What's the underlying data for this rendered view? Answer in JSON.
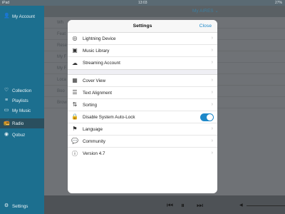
{
  "statusbar": {
    "carrier": "iPad",
    "time": "13:03",
    "battery": "27%"
  },
  "sidebar": {
    "account": "My Account",
    "collection": "Collection",
    "playlists": "Playlists",
    "mymusic": "My Music",
    "radio": "Radio",
    "qobuz": "Qobuz",
    "settings": "Settings"
  },
  "background": {
    "title": "My AIRES ⌄",
    "rows": [
      "Wh",
      "Feat",
      "Rese",
      "My F",
      "My F",
      "Loca",
      "Boo",
      "Brow"
    ]
  },
  "modal": {
    "title": "Settings",
    "close": "Close",
    "group1": [
      {
        "label": "Lightning Device",
        "icon": "antenna-icon"
      },
      {
        "label": "Music Library",
        "icon": "music-library-icon"
      },
      {
        "label": "Streaming Account",
        "icon": "cloud-icon"
      }
    ],
    "group2": [
      {
        "label": "Cover View",
        "icon": "grid-icon"
      },
      {
        "label": "Text Alignment",
        "icon": "align-icon"
      },
      {
        "label": "Sorting",
        "icon": "sort-icon"
      },
      {
        "label": "Disable System Auto-Lock",
        "icon": "lock-icon",
        "toggle": true
      },
      {
        "label": "Language",
        "icon": "flag-icon"
      },
      {
        "label": "Community",
        "icon": "chat-icon"
      },
      {
        "label": "Version 4.7",
        "icon": "info-icon"
      }
    ]
  },
  "colors": {
    "accent": "#1d88c9",
    "sidebar": "#1c6f8f"
  }
}
